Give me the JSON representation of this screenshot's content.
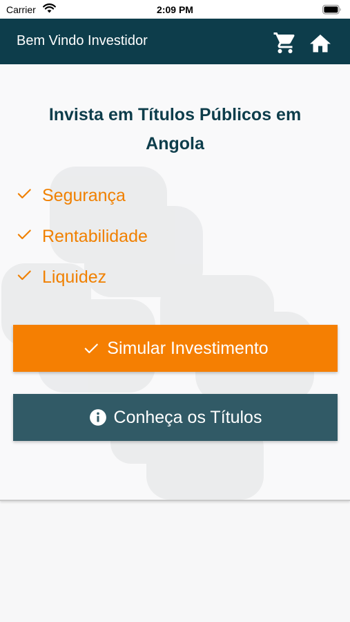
{
  "status_bar": {
    "carrier": "Carrier",
    "time": "2:09 PM",
    "icons": [
      "wifi-icon",
      "battery-icon"
    ]
  },
  "nav_bar": {
    "title": "Bem Vindo Investidor",
    "actions": [
      {
        "icon": "cart-icon"
      },
      {
        "icon": "home-icon"
      }
    ]
  },
  "main": {
    "title": "Invista em Títulos Públicos em Angola",
    "benefits": [
      {
        "icon": "check-icon",
        "label": "Segurança"
      },
      {
        "icon": "check-icon",
        "label": "Rentabilidade"
      },
      {
        "icon": "check-icon",
        "label": "Liquidez"
      }
    ],
    "buttons": {
      "simular": {
        "icon": "check-icon",
        "label": "Simular Investimento"
      },
      "conheca": {
        "icon": "info-icon",
        "label": "Conheça os Títulos"
      }
    }
  },
  "colors": {
    "nav_background": "#0d3d4b",
    "title_text": "#0d3d4b",
    "accent_orange": "#f57f02",
    "benefit_text": "#f08000",
    "secondary_button": "#315a66",
    "page_background": "#f7f7f8"
  }
}
